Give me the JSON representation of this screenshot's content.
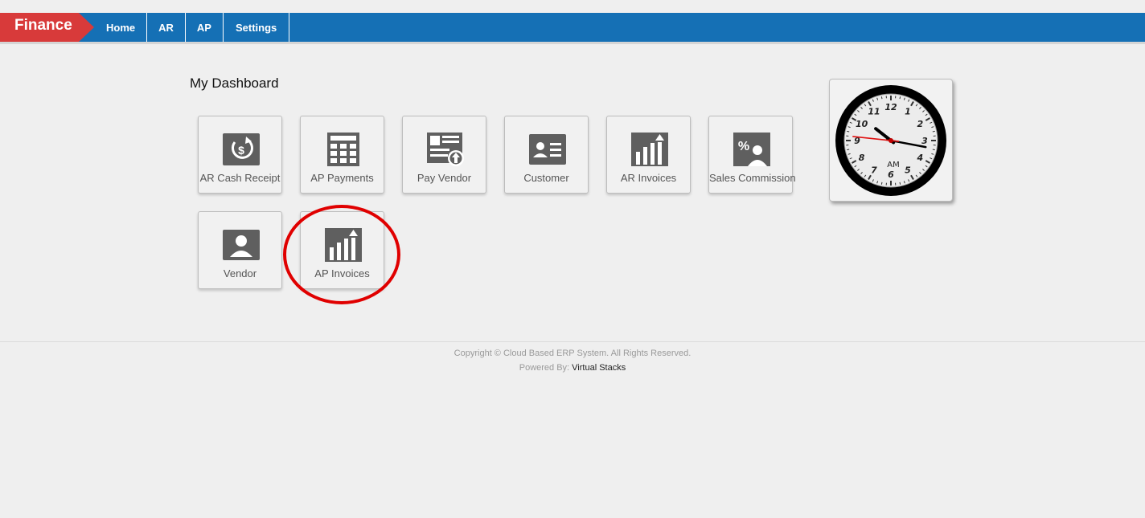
{
  "brand": {
    "label": "Finance",
    "color": "#d83a3a"
  },
  "nav": {
    "items": [
      {
        "label": "Home"
      },
      {
        "label": "AR"
      },
      {
        "label": "AP"
      },
      {
        "label": "Settings"
      }
    ],
    "color": "#1570b5"
  },
  "dashboard": {
    "title": "My Dashboard",
    "tiles": [
      {
        "label": "AR Cash Receipt",
        "icon": "cash-receipt-icon"
      },
      {
        "label": "AP Payments",
        "icon": "calculator-icon"
      },
      {
        "label": "Pay Vendor",
        "icon": "pay-vendor-icon"
      },
      {
        "label": "Customer",
        "icon": "customer-card-icon"
      },
      {
        "label": "AR Invoices",
        "icon": "bar-chart-icon"
      },
      {
        "label": "Sales Commission",
        "icon": "sales-commission-icon"
      },
      {
        "label": "Vendor",
        "icon": "vendor-icon"
      },
      {
        "label": "AP Invoices",
        "icon": "bar-chart-icon"
      }
    ]
  },
  "clock": {
    "meridiem": "AM",
    "numbers": [
      "12",
      "1",
      "2",
      "3",
      "4",
      "5",
      "6",
      "7",
      "8",
      "9",
      "10",
      "11"
    ],
    "hour": 10,
    "minute": 16,
    "second": 46
  },
  "annotation": {
    "color": "#e00000",
    "target": "AP Invoices"
  },
  "footer": {
    "copyright": "Copyright © Cloud Based ERP System. All Rights Reserved.",
    "powered_prefix": "Powered By: ",
    "powered_link": "Virtual Stacks"
  }
}
